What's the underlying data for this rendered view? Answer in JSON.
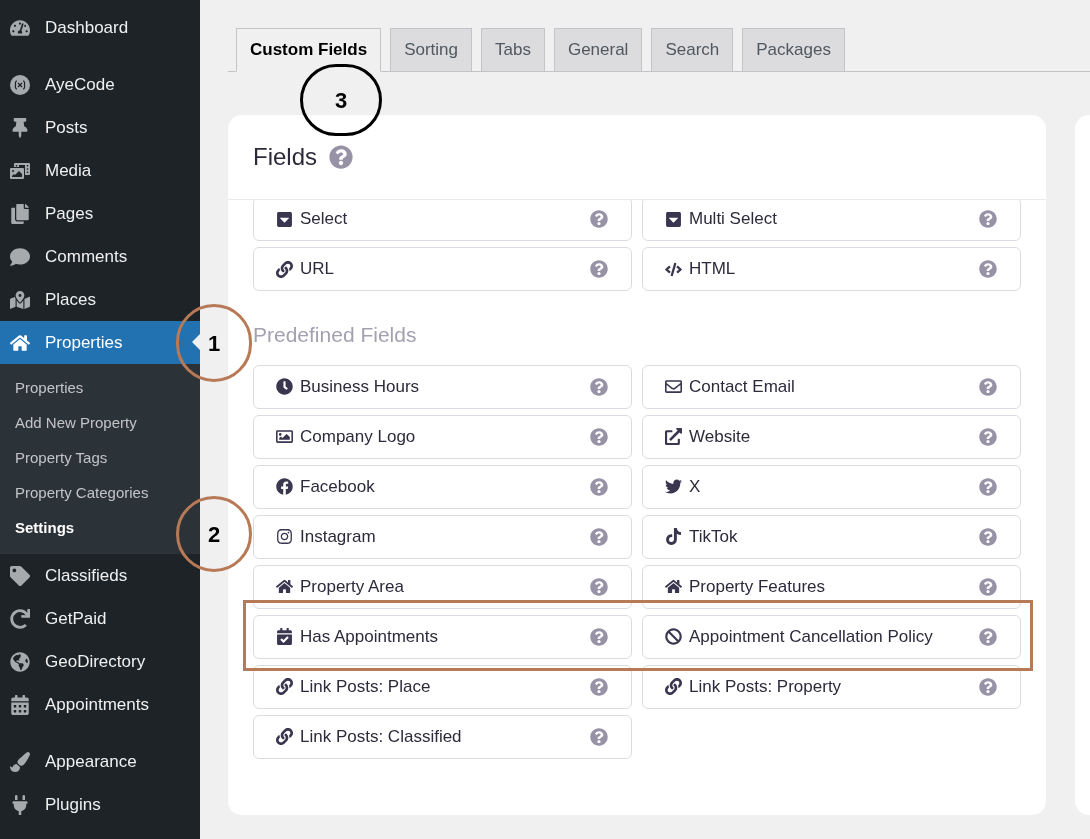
{
  "sidebar": {
    "items": [
      {
        "label": "Dashboard",
        "selected": false
      },
      {
        "label": "AyeCode",
        "selected": false
      },
      {
        "label": "Posts",
        "selected": false
      },
      {
        "label": "Media",
        "selected": false
      },
      {
        "label": "Pages",
        "selected": false
      },
      {
        "label": "Comments",
        "selected": false
      },
      {
        "label": "Places",
        "selected": false
      },
      {
        "label": "Properties",
        "selected": true,
        "children": [
          {
            "label": "Properties",
            "selected": false
          },
          {
            "label": "Add New Property",
            "selected": false
          },
          {
            "label": "Property Tags",
            "selected": false
          },
          {
            "label": "Property Categories",
            "selected": false
          },
          {
            "label": "Settings",
            "selected": true
          }
        ]
      },
      {
        "label": "Classifieds",
        "selected": false
      },
      {
        "label": "GetPaid",
        "selected": false
      },
      {
        "label": "GeoDirectory",
        "selected": false
      },
      {
        "label": "Appointments",
        "selected": false
      },
      {
        "label": "Appearance",
        "selected": false
      },
      {
        "label": "Plugins",
        "selected": false
      }
    ]
  },
  "tabs": [
    {
      "label": "Custom Fields",
      "selected": true
    },
    {
      "label": "Sorting",
      "selected": false
    },
    {
      "label": "Tabs",
      "selected": false
    },
    {
      "label": "General",
      "selected": false
    },
    {
      "label": "Search",
      "selected": false
    },
    {
      "label": "Packages",
      "selected": false
    }
  ],
  "fields_panel": {
    "title": "Fields",
    "custom_rows": [
      {
        "items": [
          {
            "label": "Select"
          },
          {
            "label": "Multi Select"
          }
        ]
      },
      {
        "items": [
          {
            "label": "URL"
          },
          {
            "label": "HTML"
          }
        ]
      }
    ],
    "predefined_heading": "Predefined Fields",
    "predefined_rows": [
      {
        "highlighted": false,
        "items": [
          {
            "label": "Business Hours"
          },
          {
            "label": "Contact Email"
          }
        ]
      },
      {
        "highlighted": false,
        "items": [
          {
            "label": "Company Logo"
          },
          {
            "label": "Website"
          }
        ]
      },
      {
        "highlighted": false,
        "items": [
          {
            "label": "Facebook"
          },
          {
            "label": "X"
          }
        ]
      },
      {
        "highlighted": false,
        "items": [
          {
            "label": "Instagram"
          },
          {
            "label": "TikTok"
          }
        ]
      },
      {
        "highlighted": false,
        "items": [
          {
            "label": "Property Area"
          },
          {
            "label": "Property Features"
          }
        ]
      },
      {
        "highlighted": true,
        "items": [
          {
            "label": "Has Appointments"
          },
          {
            "label": "Appointment Cancellation Policy"
          }
        ]
      },
      {
        "highlighted": false,
        "items": [
          {
            "label": "Link Posts: Place"
          },
          {
            "label": "Link Posts: Property"
          }
        ]
      },
      {
        "highlighted": false,
        "items": [
          {
            "label": "Link Posts: Classified"
          }
        ]
      }
    ]
  },
  "annotations": [
    {
      "label": "1",
      "color": "#b87a56"
    },
    {
      "label": "2",
      "color": "#b87a56"
    },
    {
      "label": "3",
      "color": "#000000"
    }
  ]
}
